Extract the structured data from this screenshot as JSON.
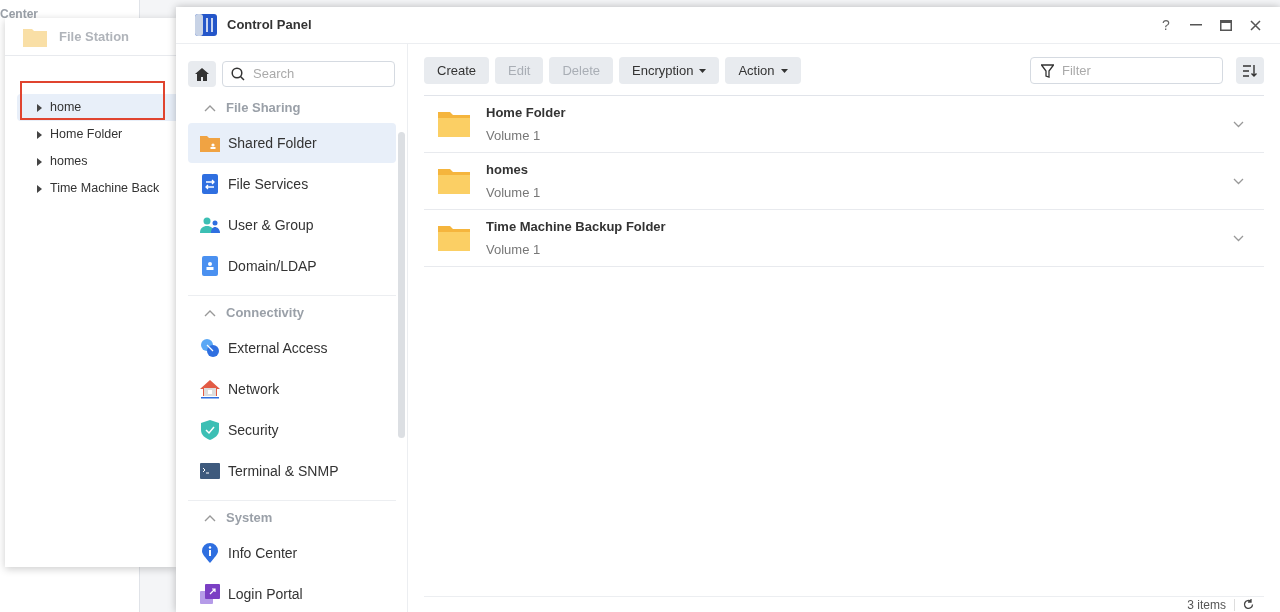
{
  "background_window": {
    "title": "Center"
  },
  "file_station": {
    "title": "File Station",
    "tree": [
      {
        "label": "home",
        "selected": true
      },
      {
        "label": "Home Folder",
        "selected": false
      },
      {
        "label": "homes",
        "selected": false
      },
      {
        "label": "Time Machine Back",
        "selected": false
      }
    ]
  },
  "control_panel": {
    "title": "Control Panel",
    "help": "?",
    "search": {
      "placeholder": "Search"
    },
    "sections": [
      {
        "title": "File Sharing",
        "expanded": true,
        "items": [
          {
            "label": "Shared Folder",
            "selected": true
          },
          {
            "label": "File Services",
            "selected": false
          },
          {
            "label": "User & Group",
            "selected": false
          },
          {
            "label": "Domain/LDAP",
            "selected": false
          }
        ]
      },
      {
        "title": "Connectivity",
        "expanded": true,
        "items": [
          {
            "label": "External Access",
            "selected": false
          },
          {
            "label": "Network",
            "selected": false
          },
          {
            "label": "Security",
            "selected": false
          },
          {
            "label": "Terminal & SNMP",
            "selected": false
          }
        ]
      },
      {
        "title": "System",
        "expanded": true,
        "items": [
          {
            "label": "Info Center",
            "selected": false
          },
          {
            "label": "Login Portal",
            "selected": false
          }
        ]
      }
    ],
    "toolbar": {
      "buttons": [
        {
          "label": "Create",
          "disabled": false,
          "dropdown": false
        },
        {
          "label": "Edit",
          "disabled": true,
          "dropdown": false
        },
        {
          "label": "Delete",
          "disabled": true,
          "dropdown": false
        },
        {
          "label": "Encryption",
          "disabled": false,
          "dropdown": true
        },
        {
          "label": "Action",
          "disabled": false,
          "dropdown": true
        }
      ],
      "filter": {
        "placeholder": "Filter"
      }
    },
    "folders": [
      {
        "name": "Home Folder",
        "volume": "Volume 1"
      },
      {
        "name": "homes",
        "volume": "Volume 1"
      },
      {
        "name": "Time Machine Backup Folder",
        "volume": "Volume 1"
      }
    ],
    "status": "3 items"
  }
}
